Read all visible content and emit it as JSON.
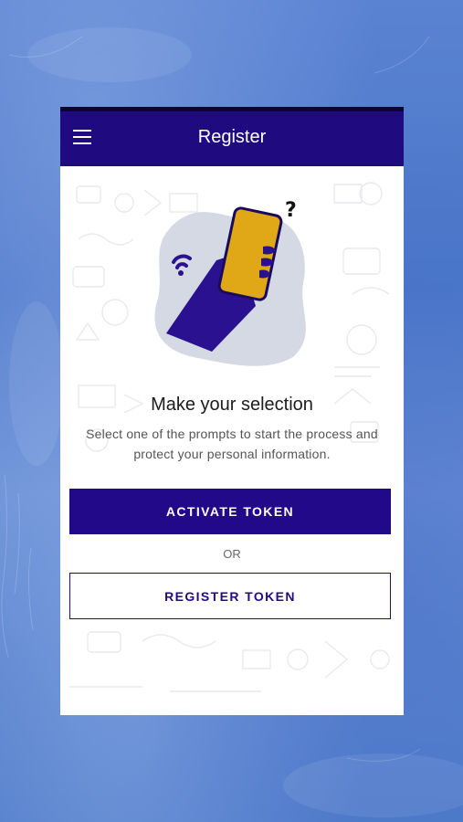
{
  "appbar": {
    "title": "Register",
    "menu_icon": "hamburger-menu-icon"
  },
  "illustration": {
    "icon": "hand-holding-phone-icon",
    "colors": {
      "hand": "#2a118f",
      "phone": "#e0a817",
      "blob": "#d4d9e3"
    }
  },
  "content": {
    "heading": "Make your selection",
    "description": "Select one of the prompts to start the process and protect your personal information."
  },
  "actions": {
    "activate_label": "ACTIVATE TOKEN",
    "or_label": "OR",
    "register_label": "REGISTER TOKEN"
  },
  "colors": {
    "primary": "#22098a",
    "appbar": "#1f0a80",
    "background": "#4f7cc9"
  }
}
